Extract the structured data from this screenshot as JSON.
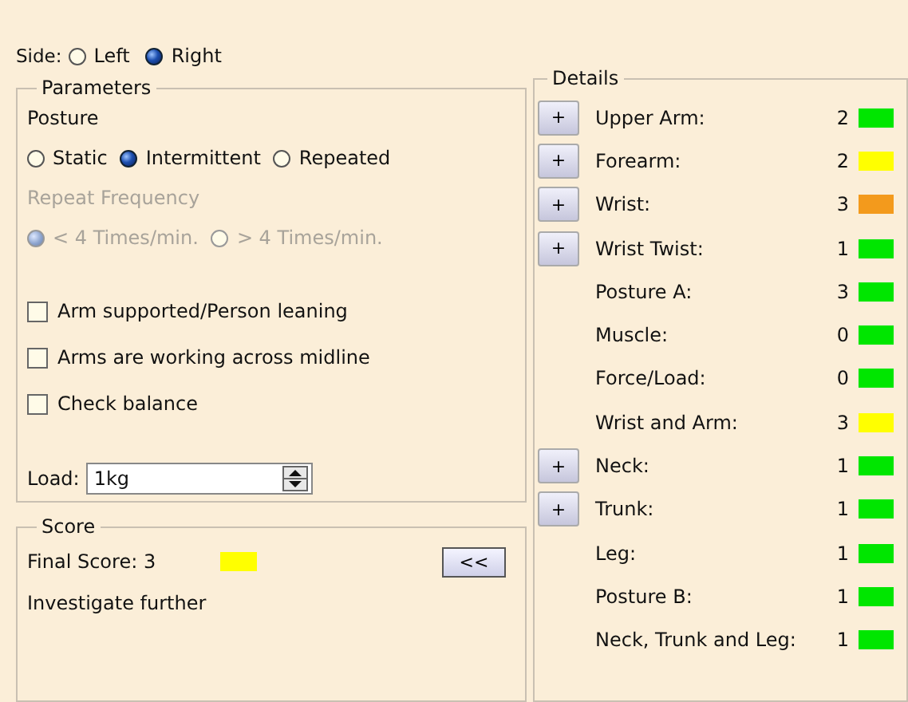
{
  "side": {
    "label": "Side:",
    "options": [
      {
        "label": "Left",
        "selected": false
      },
      {
        "label": "Right",
        "selected": true
      }
    ]
  },
  "parameters": {
    "title": "Parameters",
    "posture": {
      "label": "Posture",
      "options": [
        {
          "label": "Static",
          "selected": false
        },
        {
          "label": "Intermittent",
          "selected": true
        },
        {
          "label": "Repeated",
          "selected": false
        }
      ]
    },
    "repeat_frequency": {
      "label": "Repeat Frequency",
      "disabled": true,
      "options": [
        {
          "label": "< 4 Times/min.",
          "selected": true
        },
        {
          "label": "> 4 Times/min.",
          "selected": false
        }
      ]
    },
    "checkboxes": [
      {
        "label": "Arm supported/Person leaning",
        "checked": false
      },
      {
        "label": "Arms are working across midline",
        "checked": false
      },
      {
        "label": "Check balance",
        "checked": false
      }
    ],
    "load": {
      "label": "Load:",
      "value": "1kg"
    }
  },
  "score": {
    "title": "Score",
    "final_score": "Final Score: 3",
    "color": "#ffff00",
    "message": "Investigate further",
    "collapse_button": "<<"
  },
  "details": {
    "title": "Details",
    "rows": [
      {
        "button": "+",
        "label": "Upper Arm:",
        "value": "2",
        "color": "#00e600"
      },
      {
        "button": "+",
        "label": "Forearm:",
        "value": "2",
        "color": "#ffff00"
      },
      {
        "button": "+",
        "label": "Wrist:",
        "value": "3",
        "color": "#f39a1c"
      },
      {
        "button": "+",
        "label": "Wrist Twist:",
        "value": "1",
        "color": "#00e600"
      },
      {
        "label": "Posture A:",
        "value": "3",
        "color": "#00e600"
      },
      {
        "label": "Muscle:",
        "value": "0",
        "color": "#00e600"
      },
      {
        "label": "Force/Load:",
        "value": "0",
        "color": "#00e600"
      },
      {
        "label": "Wrist and Arm:",
        "value": "3",
        "color": "#ffff00"
      },
      {
        "button": "+",
        "label": "Neck:",
        "value": "1",
        "color": "#00e600"
      },
      {
        "button": "+",
        "label": "Trunk:",
        "value": "1",
        "color": "#00e600"
      },
      {
        "label": "Leg:",
        "value": "1",
        "color": "#00e600"
      },
      {
        "label": "Posture B:",
        "value": "1",
        "color": "#00e600"
      },
      {
        "label": "Neck, Trunk and Leg:",
        "value": "1",
        "color": "#00e600"
      }
    ]
  }
}
